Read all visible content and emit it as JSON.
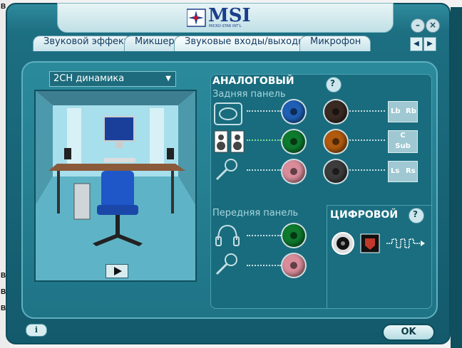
{
  "window": {
    "brand": "MSI",
    "brand_tagline": "MICRO-STAR INT'L",
    "minimize_icon": "minimize-icon",
    "close_icon": "close-icon"
  },
  "tabs": [
    {
      "label": "Звуковой эффект"
    },
    {
      "label": "Микшер"
    },
    {
      "label": "Звуковые входы/выходы"
    },
    {
      "label": "Микрофон"
    }
  ],
  "speaker_config": {
    "selected": "2CH динамика"
  },
  "analog": {
    "title": "АНАЛОГОВЫЙ",
    "rear_panel_label": "Задняя панель",
    "front_panel_label": "Передняя панель",
    "rear_jacks_left": [
      {
        "icon": "line-in-icon",
        "color": "#1f5fb5"
      },
      {
        "icon": "speakers-icon",
        "color": "#0e7a2e"
      },
      {
        "icon": "microphone-icon",
        "color": "#d98c9a"
      }
    ],
    "rear_jacks_right": [
      {
        "icon": "rear-speakers-icon",
        "color": "#3a2a24",
        "labels": [
          "Lb",
          "Rb"
        ]
      },
      {
        "icon": "center-sub-icon",
        "color": "#b05a10",
        "labels": [
          "C",
          "Sub"
        ]
      },
      {
        "icon": "side-speakers-icon",
        "color": "#3c3c3c",
        "labels": [
          "Ls",
          "Rs"
        ]
      }
    ],
    "front_jacks": [
      {
        "icon": "headphones-icon",
        "color": "#0e7a2e"
      },
      {
        "icon": "microphone-icon",
        "color": "#d98c9a"
      }
    ]
  },
  "digital": {
    "title": "ЦИФРОВОЙ"
  },
  "footer": {
    "ok_label": "OK",
    "info_label": "i"
  },
  "background_window_letters": [
    "B",
    "B",
    "B",
    "B"
  ]
}
